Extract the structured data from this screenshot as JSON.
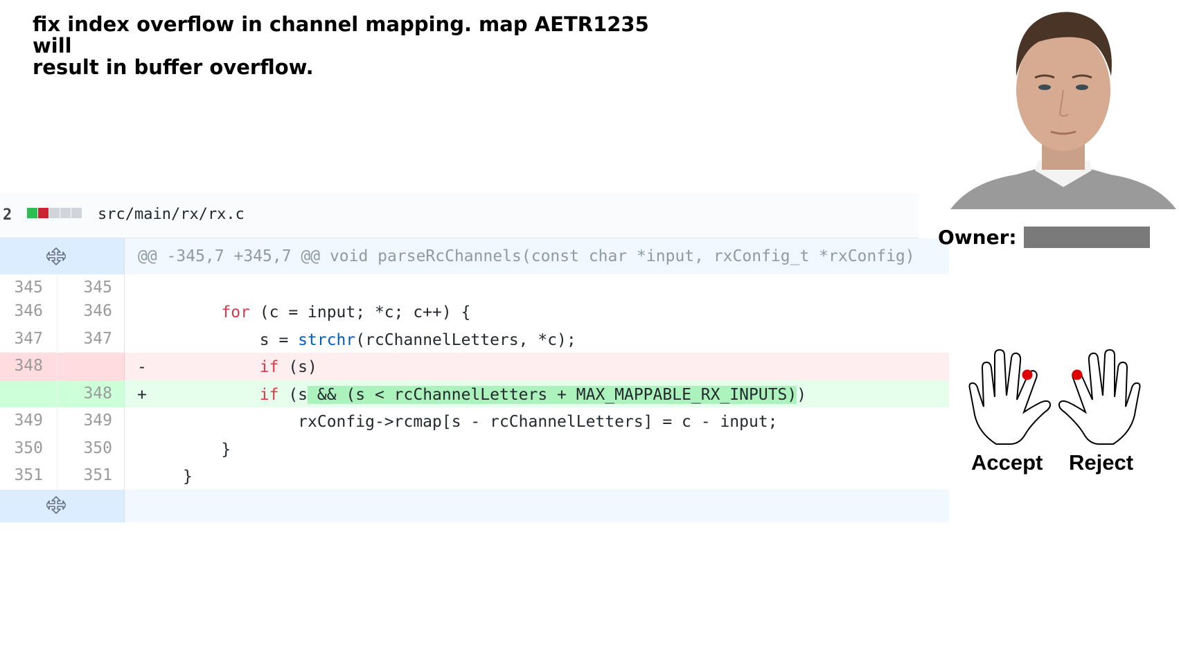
{
  "commit": {
    "message_line1": "fix index overflow in channel mapping.  map AETR1235 will",
    "message_line2": "result in buffer overflow."
  },
  "file": {
    "count": "2",
    "path": "src/main/rx/rx.c",
    "diffstat_colors": [
      "#2cbe4e",
      "#cb2431",
      "#d1d5da",
      "#d1d5da",
      "#d1d5da"
    ]
  },
  "diff": {
    "hunk_header": "@@ -345,7 +345,7 @@ void parseRcChannels(const char *input, rxConfig_t *rxConfig)",
    "lines": [
      {
        "old": "345",
        "new": "345",
        "sign": "",
        "type": "ctx",
        "text": ""
      },
      {
        "old": "346",
        "new": "346",
        "sign": "",
        "type": "ctx",
        "text": "    for (c = input; *c; c++) {"
      },
      {
        "old": "347",
        "new": "347",
        "sign": "",
        "type": "ctx",
        "text": "        s = strchr(rcChannelLetters, *c);"
      },
      {
        "old": "348",
        "new": "",
        "sign": "-",
        "type": "del",
        "text": "        if (s)"
      },
      {
        "old": "",
        "new": "348",
        "sign": "+",
        "type": "add",
        "text": "        if (s && (s < rcChannelLetters + MAX_MAPPABLE_RX_INPUTS))"
      },
      {
        "old": "349",
        "new": "349",
        "sign": "",
        "type": "ctx",
        "text": "            rxConfig->rcmap[s - rcChannelLetters] = c - input;"
      },
      {
        "old": "350",
        "new": "350",
        "sign": "",
        "type": "ctx",
        "text": "    }"
      },
      {
        "old": "351",
        "new": "351",
        "sign": "",
        "type": "ctx",
        "text": "}"
      }
    ],
    "expand_icon": "expand-icon"
  },
  "review": {
    "owner_label": "Owner:",
    "accept_label": "Accept",
    "reject_label": "Reject",
    "accept_icon": "hand-icon",
    "reject_icon": "hand-icon",
    "marker_color": "#dd0000"
  }
}
